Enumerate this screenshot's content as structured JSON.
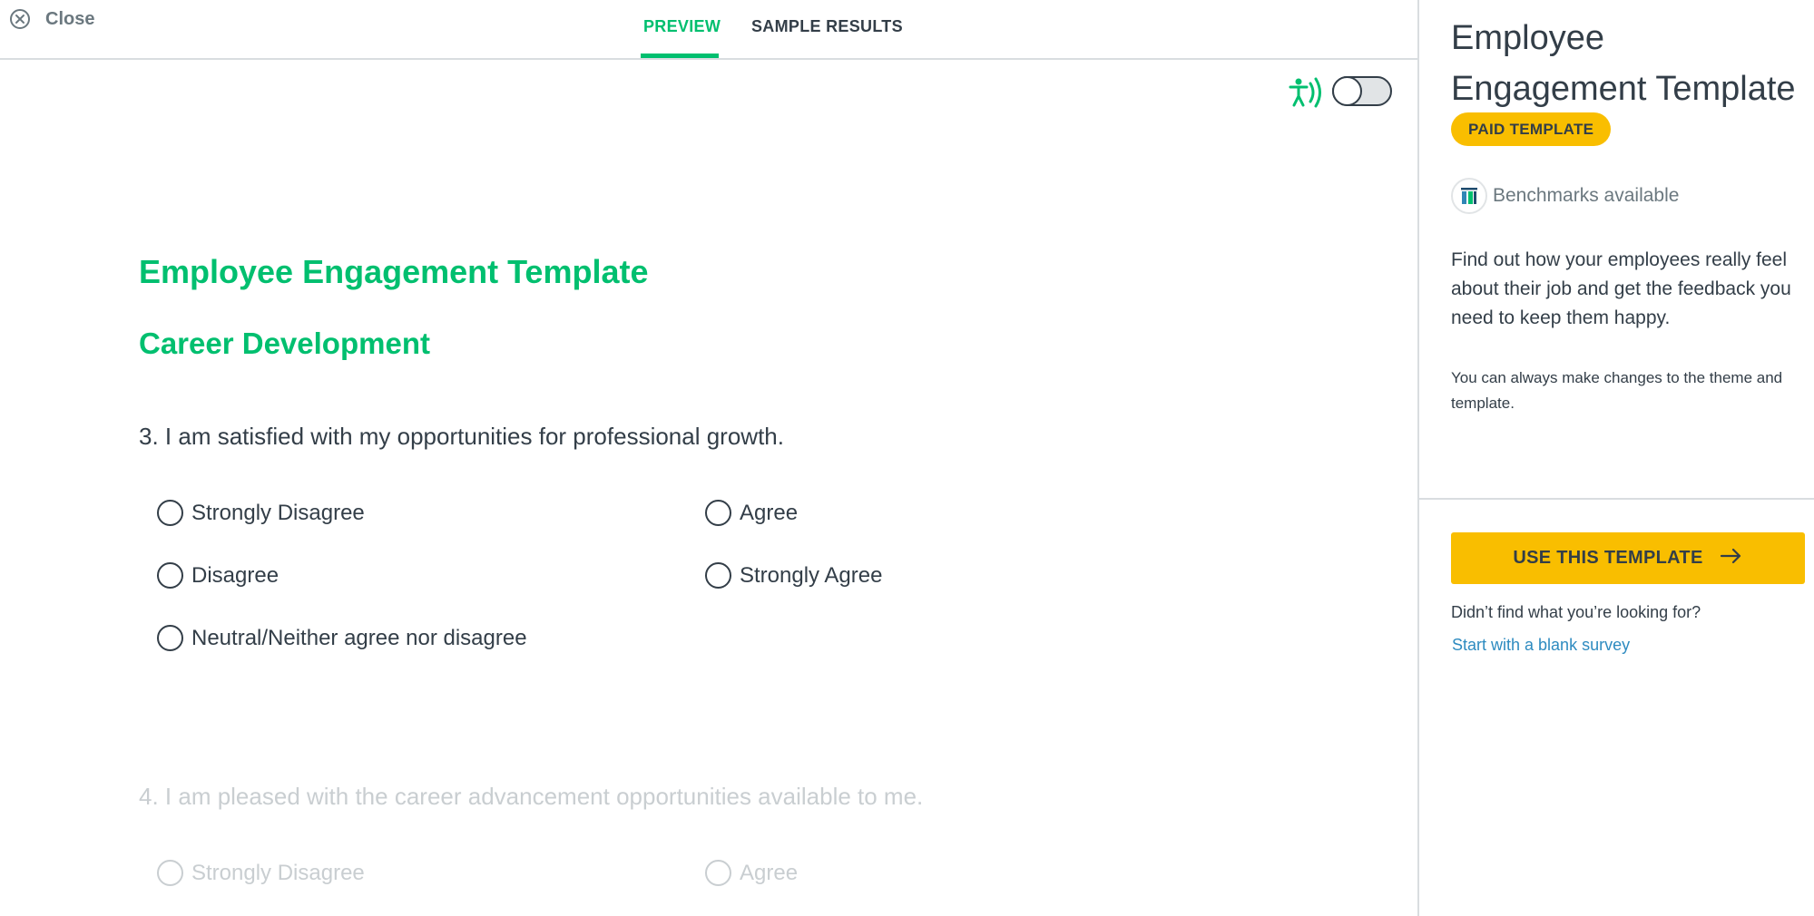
{
  "topbar": {
    "close_label": "Close",
    "tabs": [
      {
        "label": "PREVIEW",
        "active": true
      },
      {
        "label": "SAMPLE RESULTS",
        "active": false
      }
    ]
  },
  "accessibility": {
    "icon": "accessibility-audio-icon",
    "toggle_on": false
  },
  "survey": {
    "title": "Employee Engagement Template",
    "section": "Career Development",
    "questions": [
      {
        "text": "3. I am satisfied with my opportunities for professional growth.",
        "options": [
          "Strongly Disagree",
          "Disagree",
          "Neutral/Neither agree nor disagree",
          "Agree",
          "Strongly Agree"
        ]
      },
      {
        "text": "4. I am pleased with the career advancement opportunities available to me.",
        "options": [
          "Strongly Disagree",
          "Agree"
        ]
      }
    ]
  },
  "sidebar": {
    "title": "Employee Engagement Template",
    "badge": "PAID TEMPLATE",
    "benchmarks_label": "Benchmarks available",
    "description": "Find out how your employees really feel about their job and get the feedback you need to keep them happy.",
    "note": "You can always make changes to the theme and template.",
    "use_button": "USE THIS TEMPLATE",
    "not_found": "Didn’t find what you’re looking for?",
    "blank_link": "Start with a blank survey"
  },
  "colors": {
    "accent_green": "#00bf6f",
    "brand_yellow": "#f9be00",
    "text_dark": "#333e48",
    "text_muted": "#6b787f",
    "link_blue": "#2e8bc0",
    "faded": "#c9ced1"
  }
}
